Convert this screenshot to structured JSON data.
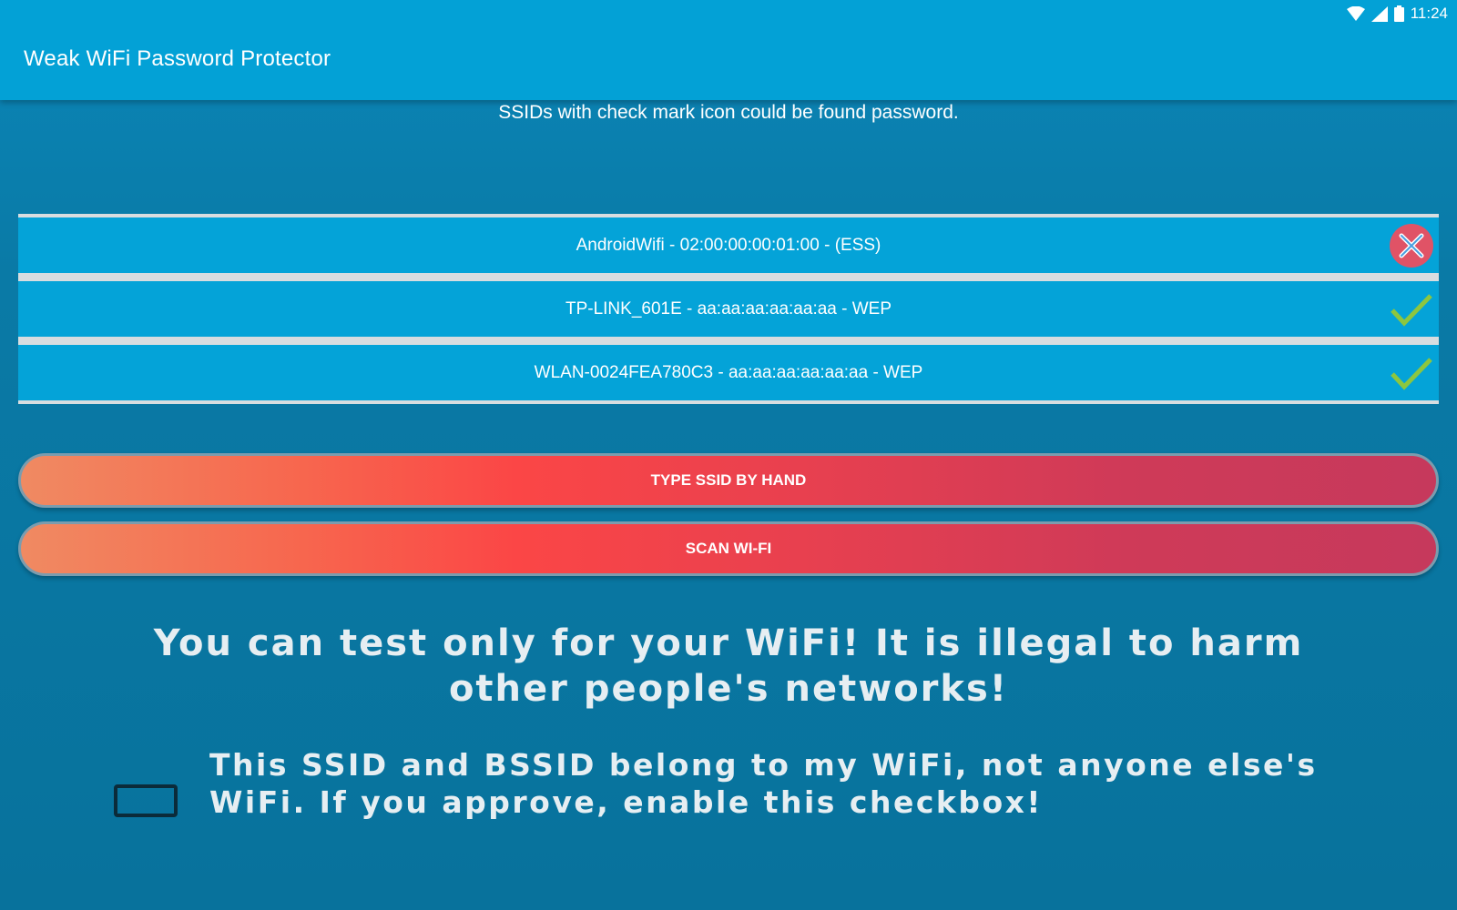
{
  "status_bar": {
    "time": "11:24",
    "icons": [
      "wifi-icon",
      "cellular-signal-icon",
      "battery-icon"
    ]
  },
  "app_bar": {
    "title": "Weak WiFi Password Protector"
  },
  "hint_text": "SSIDs with check mark icon could be found password.",
  "networks": [
    {
      "label": "AndroidWifi - 02:00:00:00:01:00 - (ESS)",
      "status": "not-found",
      "status_icon": "error-x-icon"
    },
    {
      "label": "TP-LINK_601E - aa:aa:aa:aa:aa:aa - WEP",
      "status": "found",
      "status_icon": "check-mark-icon"
    },
    {
      "label": "WLAN-0024FEA780C3 - aa:aa:aa:aa:aa:aa - WEP",
      "status": "found",
      "status_icon": "check-mark-icon"
    }
  ],
  "buttons": {
    "type_ssid": "TYPE SSID BY HAND",
    "scan_wifi": "SCAN WI-FI"
  },
  "warning_text": "You can test only for your WiFi! It is illegal to harm other people's networks!",
  "consent": {
    "checked": false,
    "text": "This SSID and BSSID belong to my WiFi, not anyone else's WiFi. If you approve, enable this checkbox!"
  },
  "colors": {
    "app_bar": "#03a1d6",
    "background": "#0a7aa6",
    "list_row": "#04a3d8",
    "error_icon": "#e05366",
    "check_icon": "#8dc63f",
    "button_gradient_start": "#f08a62",
    "button_gradient_mid": "#fb4646",
    "button_gradient_end": "#c6395c"
  }
}
